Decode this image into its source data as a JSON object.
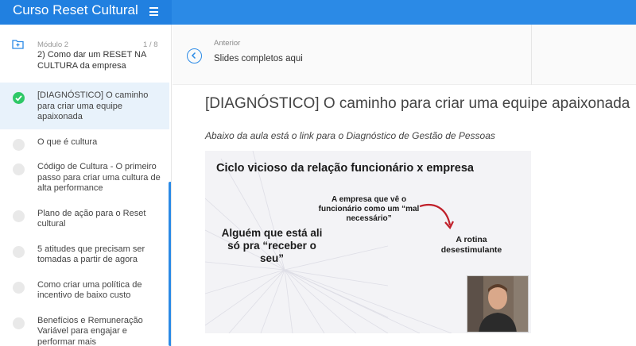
{
  "app": {
    "title": "Curso Reset Cultural"
  },
  "module": {
    "label": "Módulo 2",
    "count": "1 / 8",
    "title": "2) Como dar um RESET NA CULTURA da empresa"
  },
  "lessons": [
    {
      "title": "[DIAGNÓSTICO] O caminho para criar uma equipe apaixonada",
      "done": true,
      "active": true
    },
    {
      "title": "O que é cultura",
      "done": false
    },
    {
      "title": "Código de Cultura - O primeiro passo para criar uma cultura de alta performance",
      "done": false
    },
    {
      "title": "Plano de ação para o Reset cultural",
      "done": false
    },
    {
      "title": "5 atitudes que precisam ser tomadas a partir de agora",
      "done": false
    },
    {
      "title": "Como criar uma política de incentivo de baixo custo",
      "done": false
    },
    {
      "title": "Benefícios e Remuneração Variável para engajar e performar mais",
      "done": false
    }
  ],
  "previous": {
    "label": "Anterior",
    "title": "Slides completos aqui"
  },
  "content": {
    "title": "[DIAGNÓSTICO] O caminho para criar uma equipe apaixonada",
    "description": "Abaixo da aula está o link para o Diagnóstico de Gestão de Pessoas"
  },
  "slide": {
    "heading": "Ciclo vicioso da relação funcionário x empresa",
    "note": "A empresa que vê o funcionário como um “mal necessário”",
    "left_text": "Alguém que está ali só pra “receber o seu”",
    "right_text": "A rotina desestimulante"
  },
  "colors": {
    "accent": "#2b8ae6",
    "done": "#2ec866",
    "arrow": "#c0202a"
  },
  "icons": {
    "menu": "hamburger-icon",
    "module": "folder-plus-icon",
    "prev": "chevron-left-icon",
    "done": "check-icon"
  }
}
